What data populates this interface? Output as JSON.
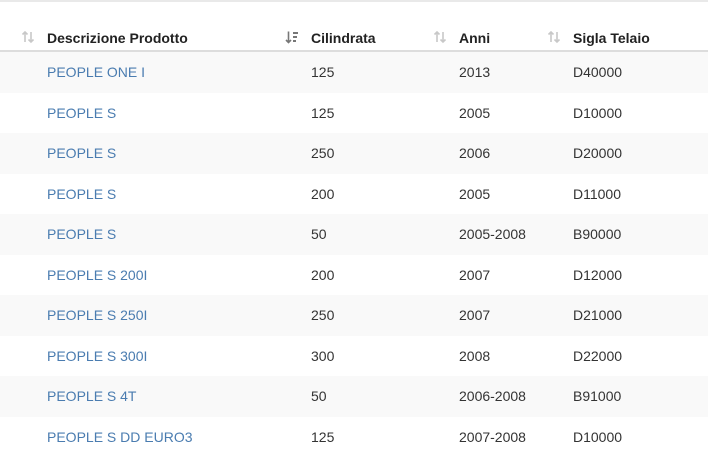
{
  "table": {
    "columns": [
      {
        "label": "Descrizione Prodotto",
        "sort_icon": "sort-icon"
      },
      {
        "label": "Cilindrata",
        "sort_icon": "sort-desc-active-icon"
      },
      {
        "label": "Anni",
        "sort_icon": "sort-icon"
      },
      {
        "label": "Sigla Telaio",
        "sort_icon": "sort-icon"
      }
    ],
    "rows": [
      {
        "descrizione": "PEOPLE ONE I",
        "cilindrata": "125",
        "anni": "2013",
        "sigla": "D40000"
      },
      {
        "descrizione": "PEOPLE S",
        "cilindrata": "125",
        "anni": "2005",
        "sigla": "D10000"
      },
      {
        "descrizione": "PEOPLE S",
        "cilindrata": "250",
        "anni": "2006",
        "sigla": "D20000"
      },
      {
        "descrizione": "PEOPLE S",
        "cilindrata": "200",
        "anni": "2005",
        "sigla": "D11000"
      },
      {
        "descrizione": "PEOPLE S",
        "cilindrata": "50",
        "anni": "2005-2008",
        "sigla": "B90000"
      },
      {
        "descrizione": "PEOPLE S 200I",
        "cilindrata": "200",
        "anni": "2007",
        "sigla": "D12000"
      },
      {
        "descrizione": "PEOPLE S 250I",
        "cilindrata": "250",
        "anni": "2007",
        "sigla": "D21000"
      },
      {
        "descrizione": "PEOPLE S 300I",
        "cilindrata": "300",
        "anni": "2008",
        "sigla": "D22000"
      },
      {
        "descrizione": "PEOPLE S 4T",
        "cilindrata": "50",
        "anni": "2006-2008",
        "sigla": "B91000"
      },
      {
        "descrizione": "PEOPLE S DD EURO3",
        "cilindrata": "125",
        "anni": "2007-2008",
        "sigla": "D10000"
      }
    ]
  },
  "colors": {
    "link": "#4a7cb0",
    "text": "#333333",
    "stripe": "#f9f9f9",
    "sort_inactive": "#c8c8c8",
    "sort_active": "#777777"
  }
}
